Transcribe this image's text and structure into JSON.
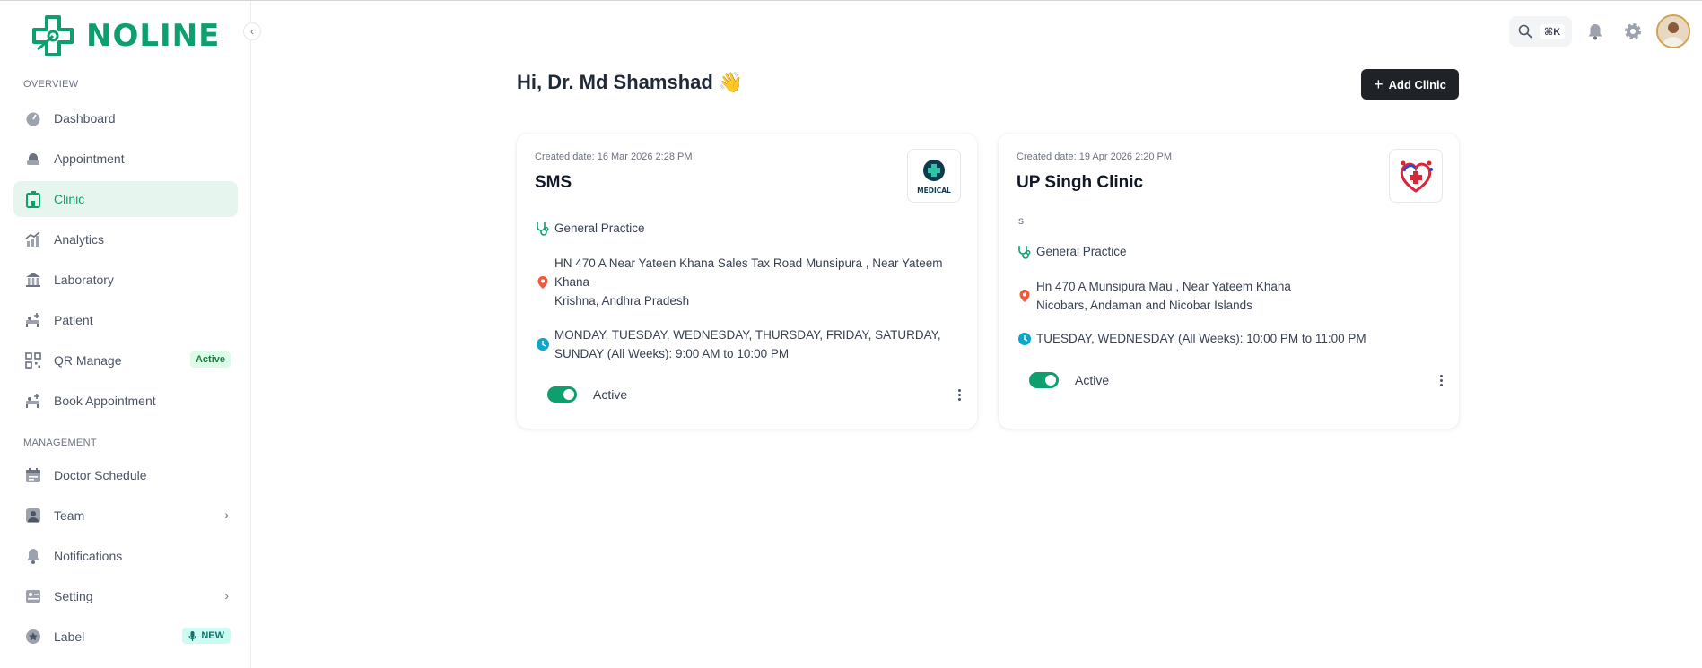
{
  "brand": {
    "name": "NOLINE",
    "color": "#0e9f6e"
  },
  "sidebar": {
    "sections": [
      {
        "label": "OVERVIEW"
      },
      {
        "label": "MANAGEMENT"
      }
    ],
    "items": [
      {
        "label": "Dashboard",
        "icon": "dashboard-icon"
      },
      {
        "label": "Appointment",
        "icon": "appointment-icon"
      },
      {
        "label": "Clinic",
        "icon": "clinic-icon",
        "active": true
      },
      {
        "label": "Analytics",
        "icon": "analytics-icon"
      },
      {
        "label": "Laboratory",
        "icon": "laboratory-icon"
      },
      {
        "label": "Patient",
        "icon": "patient-icon"
      },
      {
        "label": "QR Manage",
        "icon": "qr-code-icon",
        "badge": "Active"
      },
      {
        "label": "Book Appointment",
        "icon": "book-appointment-icon"
      },
      {
        "label": "Doctor Schedule",
        "icon": "calendar-icon"
      },
      {
        "label": "Team",
        "icon": "team-icon"
      },
      {
        "label": "Notifications",
        "icon": "bell-icon"
      },
      {
        "label": "Setting",
        "icon": "setting-icon"
      },
      {
        "label": "Label",
        "icon": "label-icon",
        "badge": "NEW"
      }
    ]
  },
  "topbar": {
    "search_shortcut": "⌘K"
  },
  "main": {
    "greeting": "Hi, Dr. Md Shamshad 👋",
    "add_button": "Add Clinic"
  },
  "clinics": [
    {
      "created": "Created date: 16 Mar 2026 2:28 PM",
      "name": "SMS",
      "subline": "",
      "specialty": "General Practice",
      "address_line1": "HN 470 A Near Yateen Khana Sales Tax Road Munsipura , Near Yateem Khana",
      "address_line2": "Krishna, Andhra Pradesh",
      "schedule": "MONDAY, TUESDAY, WEDNESDAY, THURSDAY, FRIDAY, SATURDAY, SUNDAY (All Weeks): 9:00 AM to 10:00 PM",
      "status": "Active",
      "logo_text": "MEDICAL"
    },
    {
      "created": "Created date: 19 Apr 2026 2:20 PM",
      "name": "UP Singh Clinic",
      "subline": "s",
      "specialty": "General Practice",
      "address_line1": "Hn 470 A Munsipura Mau , Near Yateem Khana",
      "address_line2": "Nicobars, Andaman and Nicobar Islands",
      "schedule": "TUESDAY, WEDNESDAY (All Weeks): 10:00 PM to 11:00 PM",
      "status": "Active",
      "logo_text": ""
    }
  ]
}
